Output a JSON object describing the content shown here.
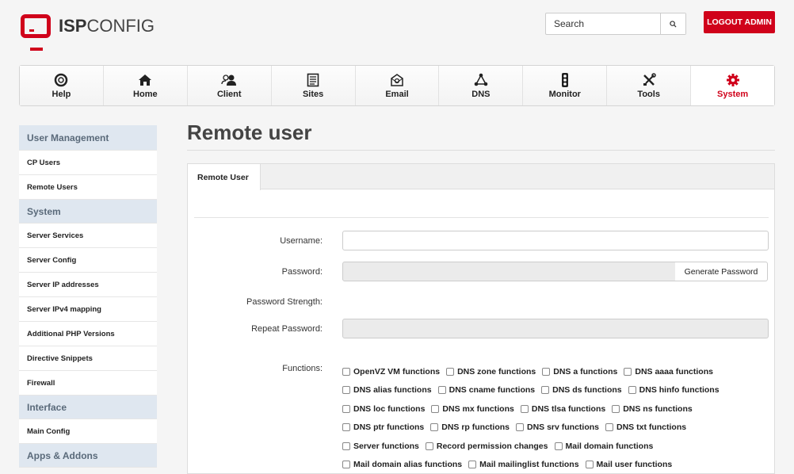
{
  "header": {
    "logo_bold": "ISP",
    "logo_light": "CONFIG",
    "search_placeholder": "Search",
    "logout_label": "LOGOUT ADMIN",
    "brand_color": "#d0021b"
  },
  "nav": [
    {
      "label": "Help",
      "icon": "help-icon"
    },
    {
      "label": "Home",
      "icon": "home-icon"
    },
    {
      "label": "Client",
      "icon": "client-icon"
    },
    {
      "label": "Sites",
      "icon": "sites-icon"
    },
    {
      "label": "Email",
      "icon": "email-icon"
    },
    {
      "label": "DNS",
      "icon": "dns-icon"
    },
    {
      "label": "Monitor",
      "icon": "monitor-icon"
    },
    {
      "label": "Tools",
      "icon": "tools-icon"
    },
    {
      "label": "System",
      "icon": "gear-icon",
      "active": true
    }
  ],
  "sidebar": {
    "cat_user_management": "User Management",
    "item_cp_users": "CP Users",
    "item_remote_users": "Remote Users",
    "cat_system": "System",
    "item_server_services": "Server Services",
    "item_server_config": "Server Config",
    "item_server_ip": "Server IP addresses",
    "item_server_ipv4": "Server IPv4 mapping",
    "item_php_versions": "Additional PHP Versions",
    "item_directive_snippets": "Directive Snippets",
    "item_firewall": "Firewall",
    "cat_interface": "Interface",
    "item_main_config": "Main Config",
    "cat_apps": "Apps & Addons"
  },
  "main": {
    "title": "Remote user",
    "tab_label": "Remote User",
    "username_label": "Username:",
    "username_value": "",
    "password_label": "Password:",
    "generate_label": "Generate Password",
    "strength_label": "Password Strength:",
    "repeat_label": "Repeat Password:",
    "functions_label": "Functions:",
    "functions": [
      [
        "OpenVZ VM functions",
        "DNS zone functions",
        "DNS a functions",
        "DNS aaaa functions"
      ],
      [
        "DNS alias functions",
        "DNS cname functions",
        "DNS ds functions",
        "DNS hinfo functions"
      ],
      [
        "DNS loc functions",
        "DNS mx functions",
        "DNS tlsa functions",
        "DNS ns functions"
      ],
      [
        "DNS ptr functions",
        "DNS rp functions",
        "DNS srv functions",
        "DNS txt functions"
      ],
      [
        "Server functions",
        "Record permission changes",
        "Mail domain functions"
      ],
      [
        "Mail domain alias functions",
        "Mail mailinglist functions",
        "Mail user functions"
      ]
    ]
  }
}
